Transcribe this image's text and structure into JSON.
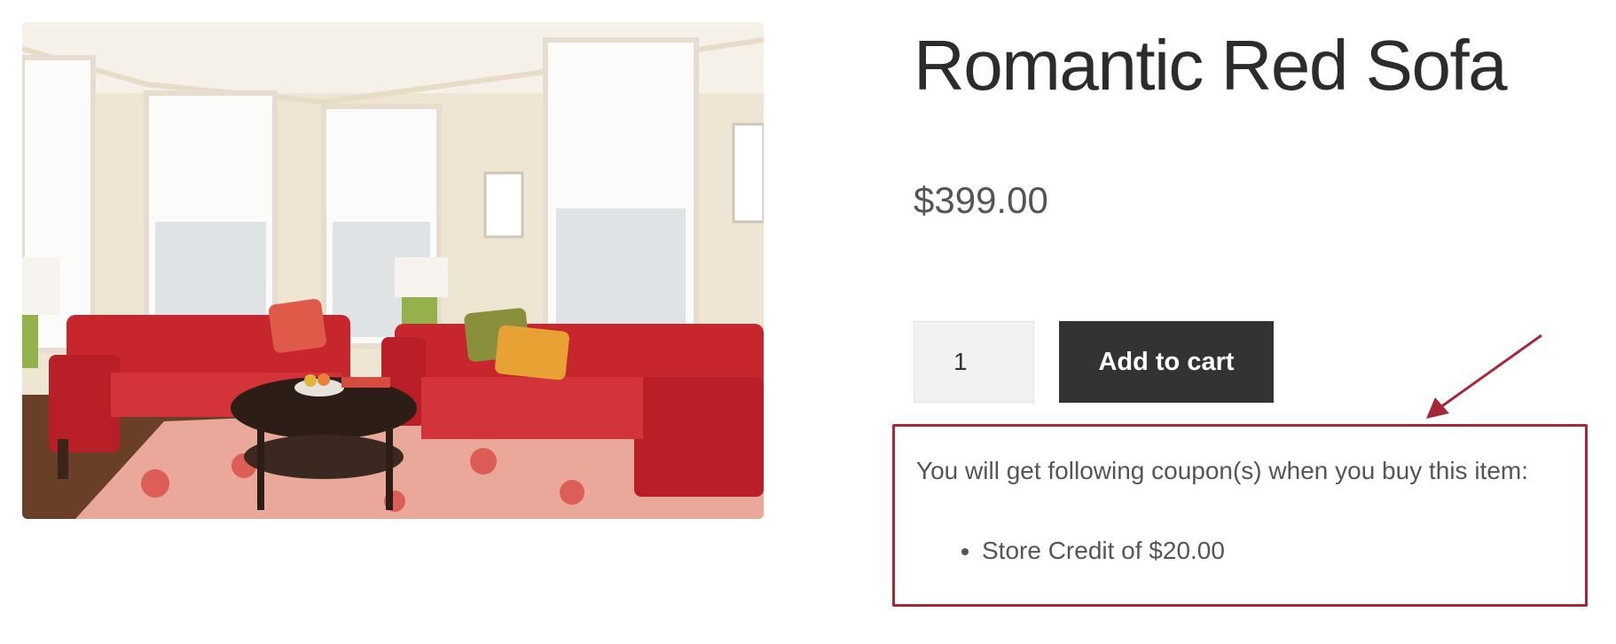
{
  "product": {
    "title": "Romantic Red Sofa",
    "price": "$399.00",
    "quantity": "1",
    "add_to_cart_label": "Add to cart"
  },
  "coupon": {
    "intro": "You will get following coupon(s) when you buy this item:",
    "items": [
      "Store Credit of $20.00"
    ]
  },
  "colors": {
    "highlight": "#a4273a",
    "button_bg": "#333333",
    "sofa": "#c8262d"
  }
}
